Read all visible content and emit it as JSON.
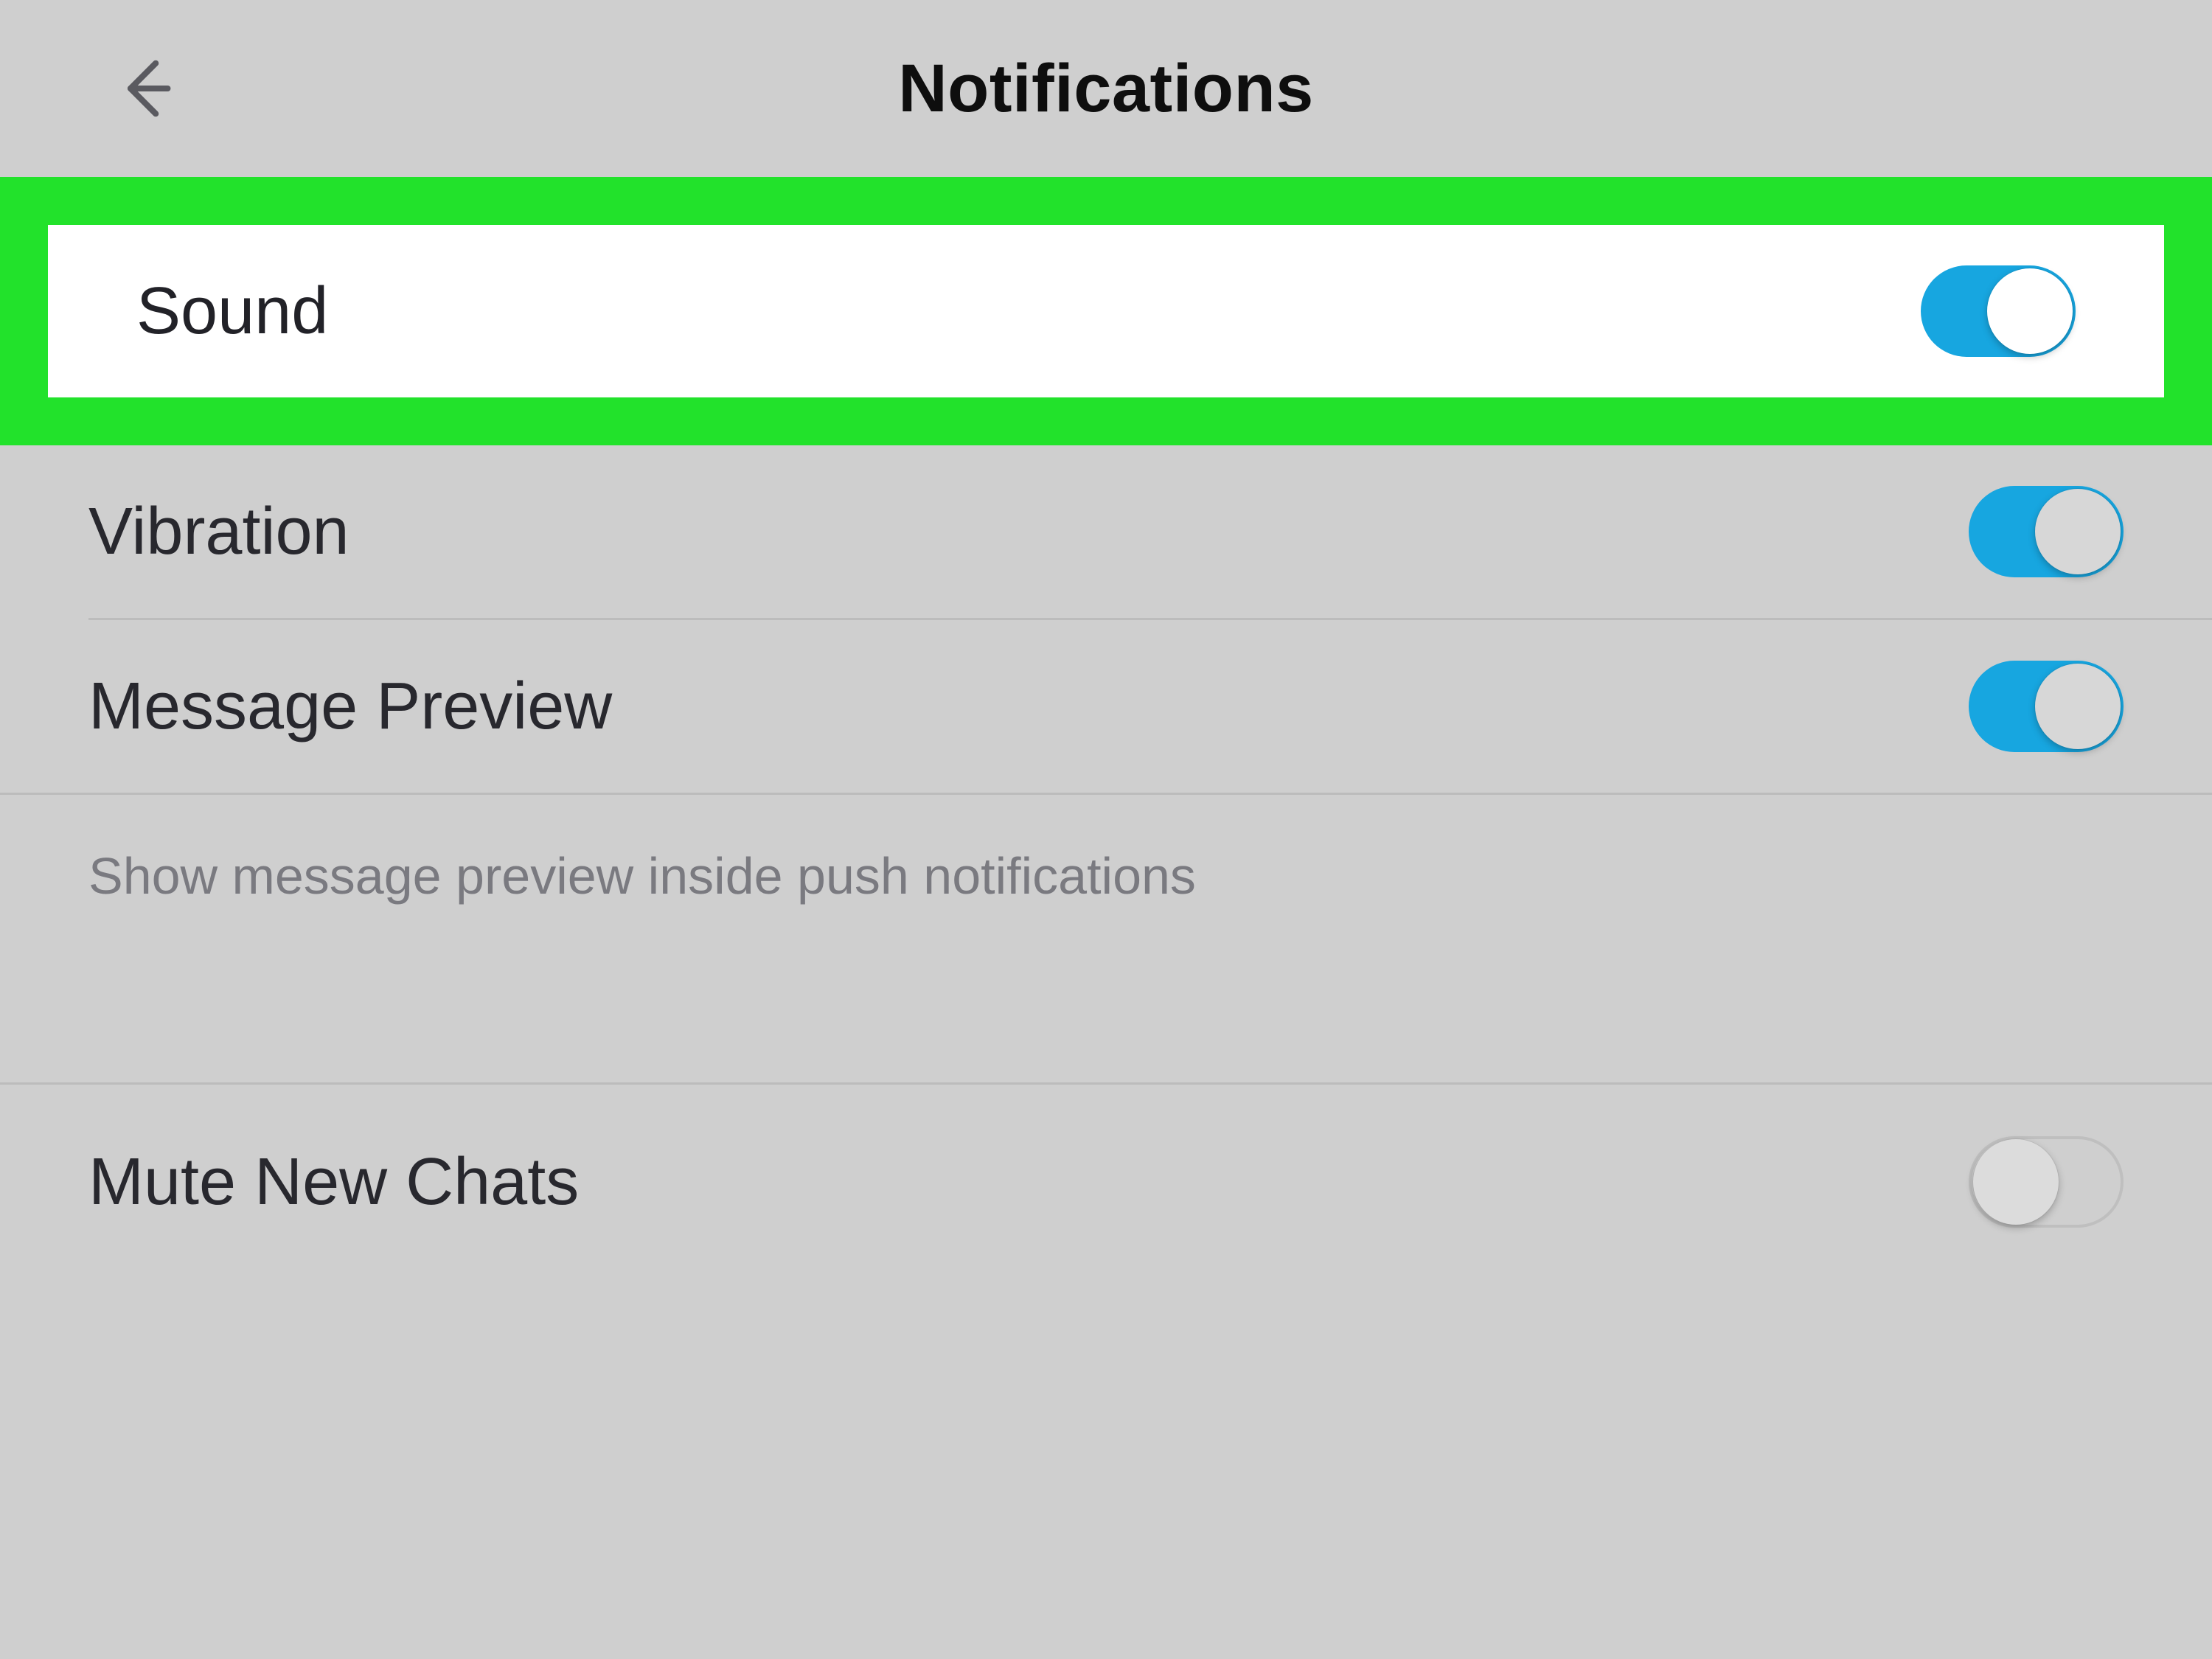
{
  "header": {
    "title": "Notifications"
  },
  "rows": {
    "sound": {
      "label": "Sound",
      "on": true
    },
    "vibration": {
      "label": "Vibration",
      "on": true
    },
    "message_preview": {
      "label": "Message Preview",
      "on": true
    },
    "mute_new_chats": {
      "label": "Mute New Chats",
      "on": false
    }
  },
  "helper": {
    "preview": "Show message preview inside push notifications"
  },
  "colors": {
    "highlight": "#22e22b",
    "toggle_on": "#17a6e0",
    "page_bg_dimmed": "#cfcfcf"
  }
}
